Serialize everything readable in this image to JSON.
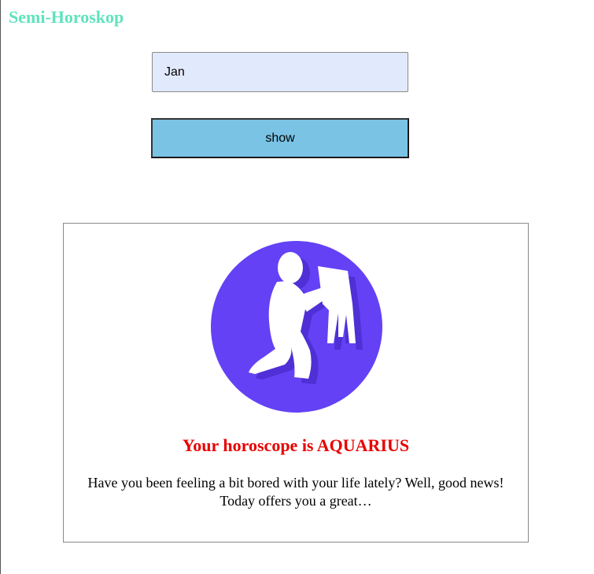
{
  "app": {
    "title": "Semi-Horoskop"
  },
  "form": {
    "month_value": "Jan",
    "show_label": "show"
  },
  "result": {
    "image_icon": "aquarius-water-bearer-icon",
    "image_color": "#6441f5",
    "heading": "Your horoscope is AQUARIUS",
    "text": "Have you been feeling a bit bored with your life lately? Well, good news! Today offers you a great…"
  },
  "colors": {
    "title": "#5fe3bd",
    "input_bg": "#e1eafc",
    "button_bg": "#7ac3e5",
    "heading": "#e80000"
  }
}
